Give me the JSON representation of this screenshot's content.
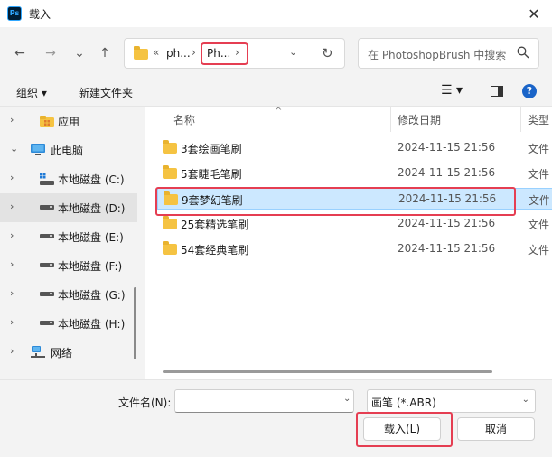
{
  "window": {
    "title": "载入",
    "app_icon": "ps-logo-icon",
    "app_icon_text": "Ps",
    "close_glyph": "✕"
  },
  "nav": {
    "back": "←",
    "forward": "→",
    "recent": "⌄",
    "up": "↑",
    "breadcrumb": {
      "overflow": "«",
      "seg1": "ph...",
      "sep1": "›",
      "seg2": "Ph...",
      "sep2": "›"
    },
    "address_dropdown": "⌄",
    "refresh": "↻",
    "search_placeholder": "在 PhotoshopBrush 中搜索"
  },
  "toolbar": {
    "organize": "组织 ▾",
    "new_folder": "新建文件夹",
    "view": "☰ ▾",
    "help": "?"
  },
  "navpane": {
    "items": [
      {
        "label": "应用",
        "chevron": "›",
        "icon": "apps-folder-icon"
      },
      {
        "label": "此电脑",
        "chevron": "⌄",
        "icon": "this-pc-icon"
      },
      {
        "label": "本地磁盘 (C:)",
        "chevron": "›",
        "icon": "windows-drive-icon"
      },
      {
        "label": "本地磁盘 (D:)",
        "chevron": "›",
        "icon": "drive-icon",
        "selected": true
      },
      {
        "label": "本地磁盘 (E:)",
        "chevron": "›",
        "icon": "drive-icon"
      },
      {
        "label": "本地磁盘 (F:)",
        "chevron": "›",
        "icon": "drive-icon"
      },
      {
        "label": "本地磁盘 (G:)",
        "chevron": "›",
        "icon": "drive-icon"
      },
      {
        "label": "本地磁盘 (H:)",
        "chevron": "›",
        "icon": "drive-icon"
      },
      {
        "label": "网络",
        "chevron": "›",
        "icon": "network-icon"
      }
    ]
  },
  "files": {
    "columns": {
      "name": "名称",
      "date": "修改日期",
      "type": "类型",
      "sort_arrow": "^"
    },
    "rows": [
      {
        "name": "3套绘画笔刷",
        "date": "2024-11-15 21:56",
        "type": "文件"
      },
      {
        "name": "5套睫毛笔刷",
        "date": "2024-11-15 21:56",
        "type": "文件"
      },
      {
        "name": "9套梦幻笔刷",
        "date": "2024-11-15 21:56",
        "type": "文件",
        "selected": true
      },
      {
        "name": "25套精选笔刷",
        "date": "2024-11-15 21:56",
        "type": "文件"
      },
      {
        "name": "54套经典笔刷",
        "date": "2024-11-15 21:56",
        "type": "文件"
      }
    ]
  },
  "footer": {
    "filename_label": "文件名(N):",
    "filename_value": "",
    "filetype": "画笔 (*.ABR)",
    "dropdown": "⌄",
    "load_button": "载入(L)",
    "cancel_button": "取消"
  },
  "colors": {
    "highlight": "#e53e52",
    "selection": "#cce8ff",
    "folder": "#f5c342"
  }
}
